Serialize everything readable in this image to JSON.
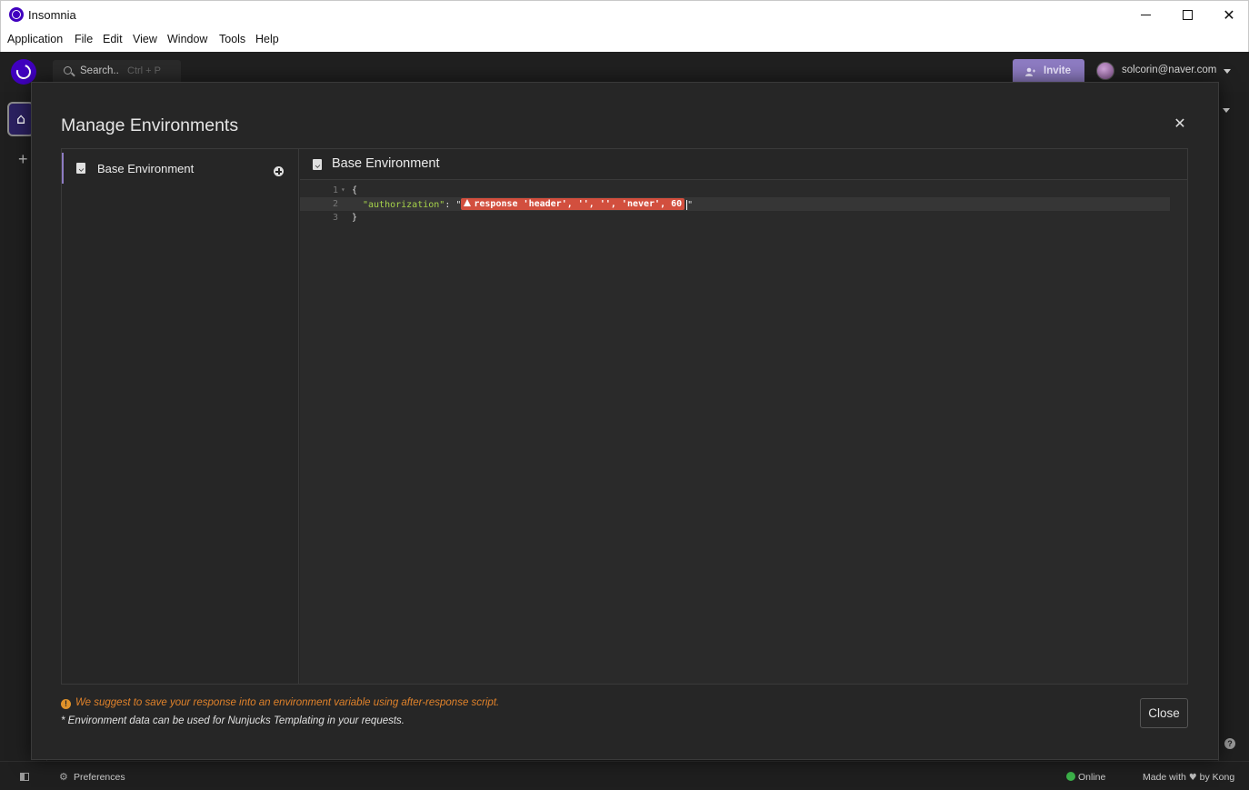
{
  "window": {
    "title": "Insomnia"
  },
  "menu": [
    "Application",
    "File",
    "Edit",
    "View",
    "Window",
    "Tools",
    "Help"
  ],
  "header": {
    "search_label": "Search..",
    "search_shortcut": "Ctrl + P",
    "invite_label": "Invite",
    "user_email": "solcorin@naver.com"
  },
  "modal": {
    "title": "Manage Environments",
    "sidebar_item": "Base Environment",
    "editor_title": "Base Environment",
    "code": {
      "line_numbers": [
        "1",
        "2",
        "3"
      ],
      "line1": "{",
      "key": "\"authorization\"",
      "colon": ": \"",
      "tag_text": "response 'header', '', '', 'never', 60",
      "close_quote": "\"",
      "line3": "}"
    },
    "hint": "We suggest to save your response into an environment variable using after-response script.",
    "note": "* Environment data can be used for Nunjucks Templating in your requests.",
    "close_label": "Close"
  },
  "statusbar": {
    "preferences": "Preferences",
    "online": "Online",
    "made_with_prefix": "Made with",
    "made_with_suffix": "by Kong"
  },
  "icons": {
    "home": "home-icon",
    "search": "search-icon",
    "warning": "warning-icon",
    "gear": "gear-icon",
    "heart": "heart-icon"
  },
  "colors": {
    "accent": "#8e7cc3",
    "brand": "#4000bf",
    "tag_error": "#d24f3e",
    "hint": "#e0822a",
    "online": "#3cb34a",
    "json_key": "#a6d34a"
  }
}
